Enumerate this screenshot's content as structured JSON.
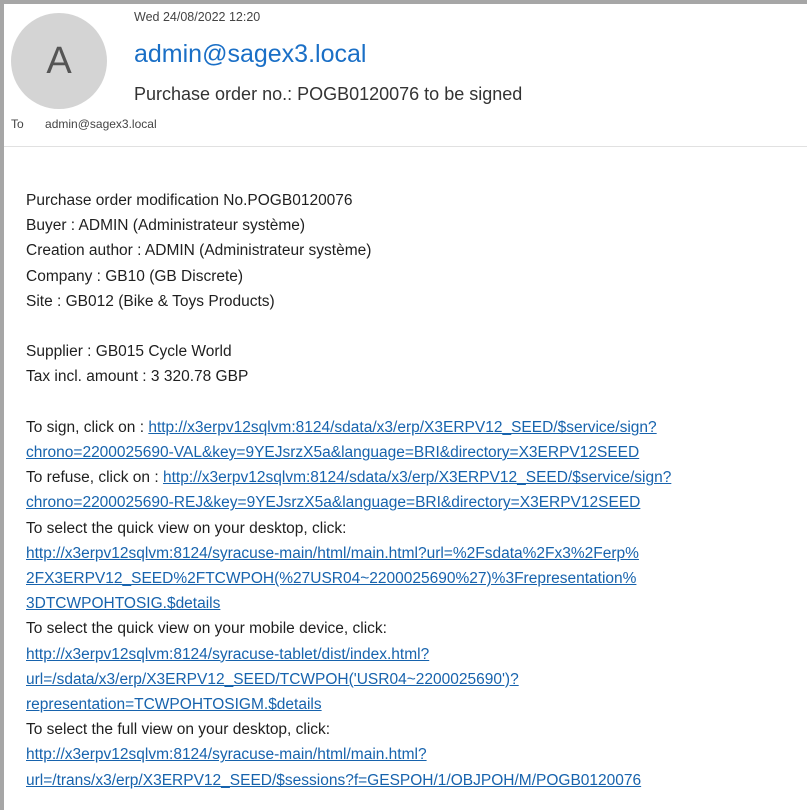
{
  "header": {
    "date": "Wed 24/08/2022 12:20",
    "avatar_letter": "A",
    "sender": "admin@sagex3.local",
    "subject": "Purchase order no.: POGB0120076 to be signed",
    "to_label": "To",
    "to_address": "admin@sagex3.local"
  },
  "body": {
    "details": [
      "Purchase order modification No.POGB0120076",
      "Buyer : ADMIN (Administrateur système)",
      "Creation author : ADMIN (Administrateur système)",
      "Company : GB10 (GB Discrete)",
      "Site : GB012 (Bike & Toys Products)"
    ],
    "supplier": "Supplier : GB015 Cycle World",
    "amount": "Tax incl. amount : 3 320.78 GBP",
    "sign": {
      "prefix": "To sign, click on : ",
      "link_line1": "http://x3erpv12sqlvm:8124/sdata/x3/erp/X3ERPV12_SEED/$service/sign?",
      "link_line2": "chrono=2200025690-VAL&key=9YEJsrzX5a&language=BRI&directory=X3ERPV12SEED"
    },
    "refuse": {
      "prefix": "To refuse, click on : ",
      "link_line1": "http://x3erpv12sqlvm:8124/sdata/x3/erp/X3ERPV12_SEED/$service/sign?",
      "link_line2": "chrono=2200025690-REJ&key=9YEJsrzX5a&language=BRI&directory=X3ERPV12SEED"
    },
    "quick_desktop": {
      "label": "To select the quick view on your desktop, click:",
      "link_line1": "http://x3erpv12sqlvm:8124/syracuse-main/html/main.html?url=%2Fsdata%2Fx3%2Ferp%",
      "link_line2": "2FX3ERPV12_SEED%2FTCWPOH(%27USR04~2200025690%27)%3Frepresentation%",
      "link_line3": "3DTCWPOHTOSIG.$details"
    },
    "quick_mobile": {
      "label": "To select the quick view on your mobile device, click:",
      "link_line1": "http://x3erpv12sqlvm:8124/syracuse-tablet/dist/index.html?",
      "link_line2": "url=/sdata/x3/erp/X3ERPV12_SEED/TCWPOH('USR04~2200025690')?",
      "link_line3": "representation=TCWPOHTOSIGM.$details"
    },
    "full_desktop": {
      "label": "To select the full view on your desktop, click:",
      "link_line1": "http://x3erpv12sqlvm:8124/syracuse-main/html/main.html?",
      "link_line2": "url=/trans/x3/erp/X3ERPV12_SEED/$sessions?f=GESPOH/1/OBJPOH/M/POGB0120076"
    }
  }
}
